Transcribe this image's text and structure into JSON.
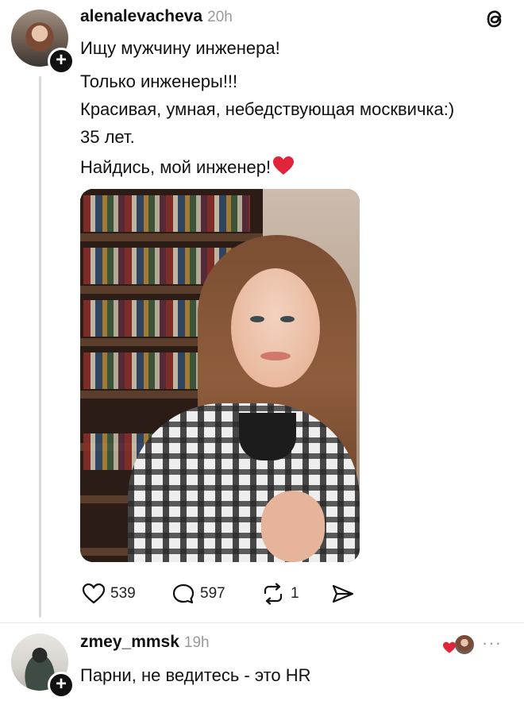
{
  "post": {
    "username": "alenalevacheva",
    "time": "20h",
    "lines": [
      "Ищу мужчину инженера!",
      "Только инженеры!!!",
      "Красивая, умная, небедствующая москвичка:)",
      "35 лет.",
      "Найдись, мой инженер!"
    ],
    "heart_emoji": "❤️",
    "likes": "539",
    "comments": "597",
    "reposts": "1"
  },
  "reply": {
    "username": "zmey_mmsk",
    "time": "19h",
    "text": "Парни, не ведитесь - это HR",
    "more": "···"
  },
  "icons": {
    "threads": "threads-logo-icon",
    "like": "heart-outline-icon",
    "comment": "comment-bubble-icon",
    "repost": "repost-icon",
    "share": "send-icon",
    "follow": "plus-icon"
  },
  "colors": {
    "text": "#111111",
    "muted": "#9a9a9a",
    "heart_red": "#e0243a",
    "thread_line": "#d9d9d9"
  }
}
